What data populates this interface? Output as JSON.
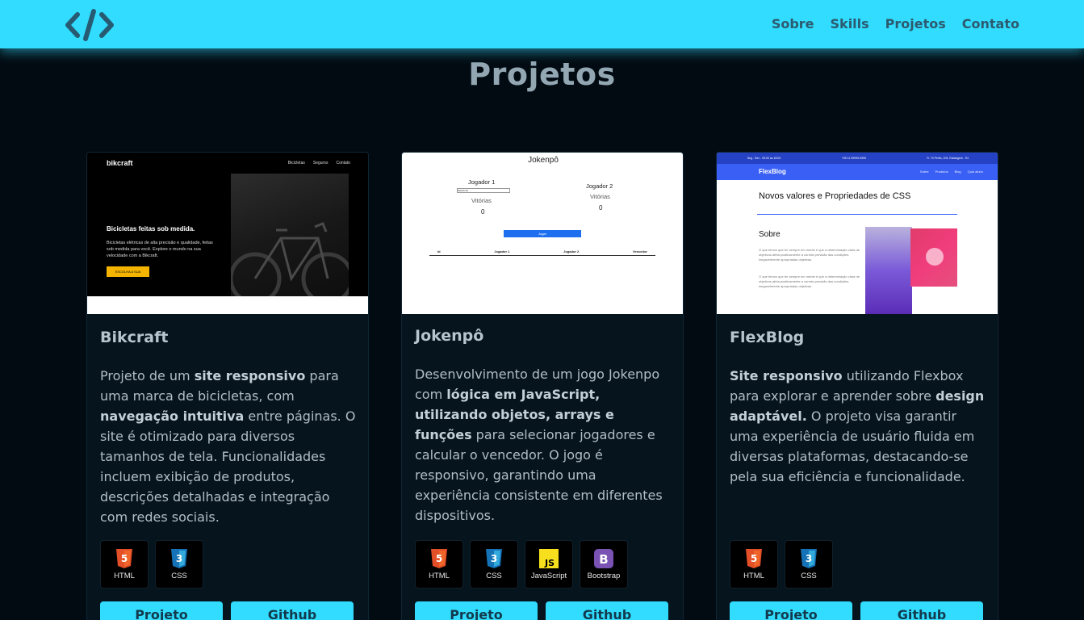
{
  "header": {
    "logo_icon": "code-brackets-icon",
    "nav": [
      "Sobre",
      "Skills",
      "Projetos",
      "Contato"
    ]
  },
  "section": {
    "title": "Projetos"
  },
  "projects": [
    {
      "title": "Bikcraft",
      "thumb": {
        "brand": "bikcraft",
        "nav": [
          "Bicicletas",
          "Seguros",
          "Contato"
        ],
        "hero_title": "Bicicletas feitas sob medida.",
        "hero_text": "Bicicletas elétricas de alta precisão e qualidade, feitas sob medida para você. Explore o mundo na sua velocidade com a Bikcraft.",
        "cta": "ESCOLHA A SUA"
      },
      "desc": {
        "p1": "Projeto de um ",
        "b1": "site responsivo",
        "p2": " para uma marca de bicicletas, com ",
        "b2": "navegação intuitiva",
        "p3": " entre páginas. O site é otimizado para diversos tamanhos de tela. Funcionalidades incluem exibição de produtos, descrições detalhadas e integração com redes sociais."
      },
      "techs": [
        "HTML",
        "CSS"
      ],
      "buttons": {
        "project": "Projeto",
        "github": "Github"
      }
    },
    {
      "title": "Jokenpô",
      "thumb": {
        "title": "Jokenpô",
        "player1": "Jogador 1",
        "player2": "Jogador 2",
        "select": "Selecione",
        "wins1": "Vitórias",
        "wins2": "Vitórias",
        "score1": "0",
        "score2": "0",
        "play_button": "Jogar",
        "table_headers": [
          "Id",
          "Jogador 1",
          "Jogador 2",
          "Vencedor"
        ]
      },
      "desc": {
        "p1": "Desenvolvimento de um jogo Jokenpo com ",
        "b1": "lógica em JavaScript, utilizando objetos, arrays e funções",
        "p2": " para selecionar jogadores e calcular o vencedor. O jogo é responsivo, garantindo uma experiência consistente em diferentes dispositivos."
      },
      "techs": [
        "HTML",
        "CSS",
        "JavaScript",
        "Bootstrap"
      ],
      "buttons": {
        "project": "Projeto",
        "github": "Github"
      }
    },
    {
      "title": "FlexBlog",
      "thumb": {
        "topbar": [
          "Seg - Sex - 09:00 às 18:00",
          "+55 11 99999-9999",
          "R. 70 Perfis, 203, Estalagem - RJ"
        ],
        "brand": "FlexBlog",
        "nav": [
          "Sobre",
          "Produtos",
          "Blog",
          "Qual aluno"
        ],
        "heading": "Novos valores e Propriedades de CSS",
        "subheading": "Sobre",
        "para": "O que temos que ter sempre em mente é que a determinação clara de objetivos afeta positivamente a correta previsão das condições inegavelmente apropriadas objetivas."
      },
      "desc": {
        "b1": "Site responsivo",
        "p1": " utilizando Flexbox para explorar e aprender sobre ",
        "b2": "design adaptável.",
        "p2": " O projeto visa garantir uma experiência de usuário fluida em diversas plataformas, destacando-se pela sua eficiência e funcionalidade."
      },
      "techs": [
        "HTML",
        "CSS"
      ],
      "buttons": {
        "project": "Projeto",
        "github": "Github"
      }
    }
  ],
  "tech_icons": {
    "HTML": "html5-icon",
    "CSS": "css3-icon",
    "JavaScript": "javascript-icon",
    "Bootstrap": "bootstrap-icon"
  },
  "colors": {
    "accent": "#31dcff",
    "background": "#030b12",
    "card": "#06141e"
  }
}
